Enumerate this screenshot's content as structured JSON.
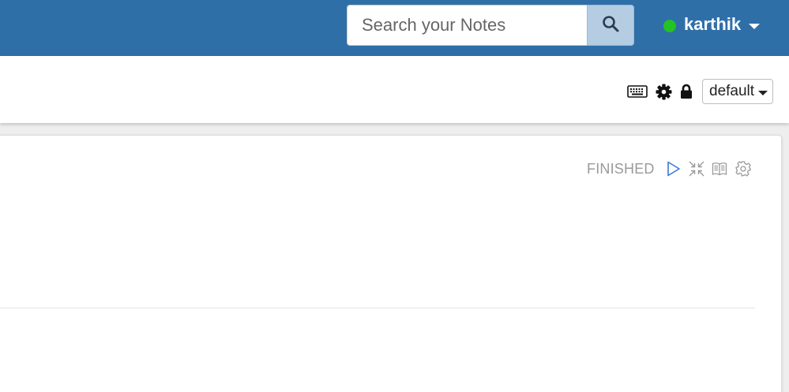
{
  "navbar": {
    "search": {
      "placeholder": "Search your Notes",
      "value": ""
    },
    "search_button_icon": "search-icon",
    "user": {
      "name": "karthik",
      "status_color": "#22c322"
    },
    "background_color": "#2f6fa8"
  },
  "note_toolbar": {
    "icons": [
      "keyboard-icon",
      "gear-icon",
      "lock-icon"
    ],
    "interpreter": {
      "label": "default"
    }
  },
  "paragraph": {
    "status": "FINISHED",
    "icons": [
      "run-icon",
      "collapse-icon",
      "book-icon",
      "settings-icon"
    ],
    "run_icon_color": "#3a7bd5"
  }
}
